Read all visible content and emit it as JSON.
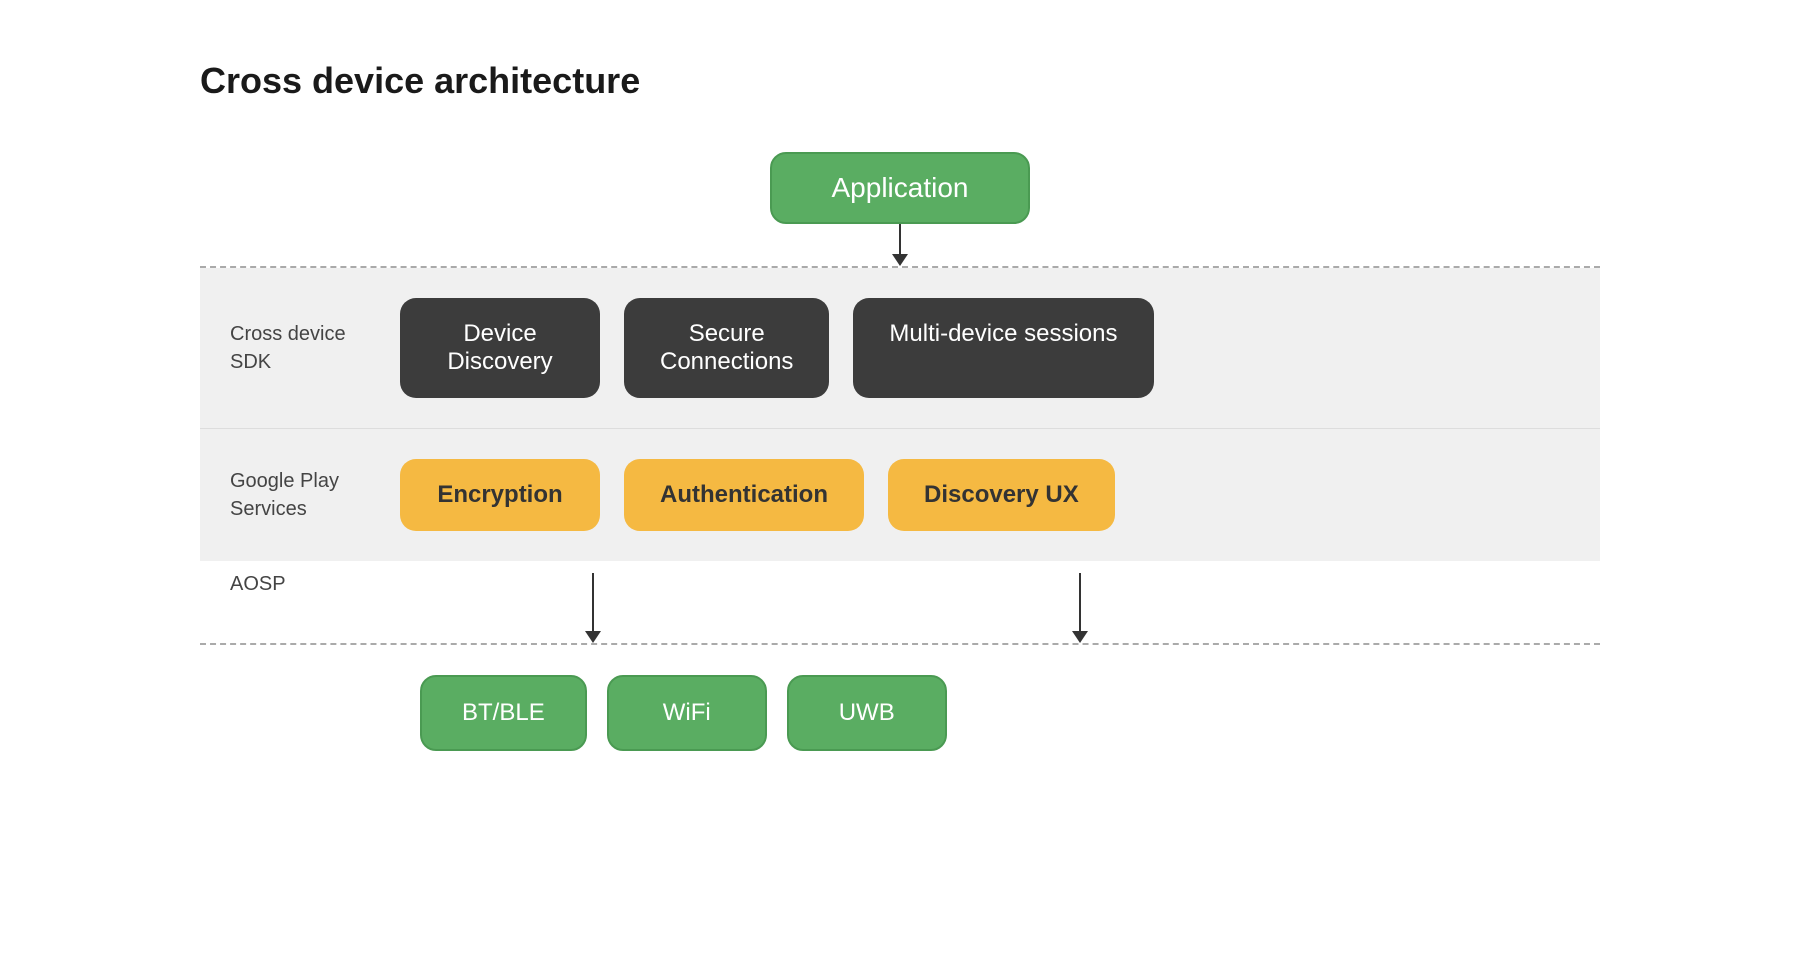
{
  "title": "Cross device architecture",
  "app_box": "Application",
  "sdk_label": "Cross device\nSDK",
  "sdk_items": [
    {
      "id": "device-discovery",
      "label": "Device\nDiscovery"
    },
    {
      "id": "secure-connections",
      "label": "Secure\nConnections"
    },
    {
      "id": "multi-device",
      "label": "Multi-device sessions"
    }
  ],
  "play_label": "Google Play\nServices",
  "play_items": [
    {
      "id": "encryption",
      "label": "Encryption"
    },
    {
      "id": "authentication",
      "label": "Authentication"
    },
    {
      "id": "discovery-ux",
      "label": "Discovery UX"
    }
  ],
  "aosp_label": "AOSP",
  "bottom_items": [
    {
      "id": "bt-ble",
      "label": "BT/BLE"
    },
    {
      "id": "wifi",
      "label": "WiFi"
    },
    {
      "id": "uwb",
      "label": "UWB"
    }
  ],
  "colors": {
    "green": "#5aad62",
    "green_border": "#4a9a52",
    "dark": "#3c3c3c",
    "yellow": "#f5b942",
    "grey_bg": "#f0f0f0",
    "text_dark": "#1a1a1a",
    "text_muted": "#555555"
  }
}
